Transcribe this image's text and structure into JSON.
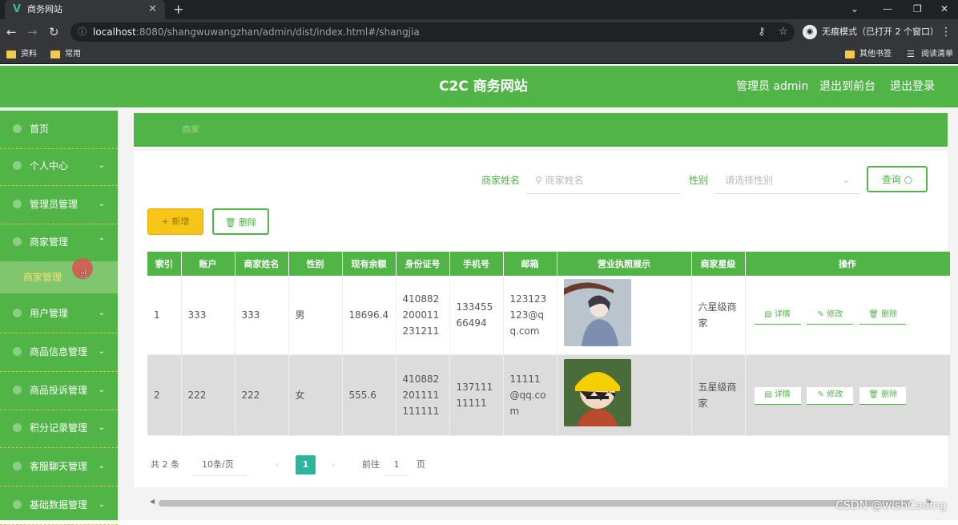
{
  "browser": {
    "tab_title": "商务网站",
    "tab_logo": "V",
    "close_glyph": "✕",
    "newtab_glyph": "+",
    "url_host": "localhost",
    "url_path": ":8080/shangwuwangzhan/admin/dist/index.html#/shangjia",
    "incognito_text": "无痕模式（已打开 2 个窗口）",
    "bookmarks": [
      "资料",
      "常用"
    ],
    "other_bookmarks": "其他书签",
    "reading_list": "阅读清单"
  },
  "header": {
    "title": "C2C 商务网站",
    "admin_label": "管理员 admin",
    "to_front": "退出到前台",
    "logout": "退出登录"
  },
  "sidebar": {
    "items": [
      {
        "label": "首页",
        "chevron": ""
      },
      {
        "label": "个人中心",
        "chevron": "⌄"
      },
      {
        "label": "管理员管理",
        "chevron": "⌄"
      },
      {
        "label": "商家管理",
        "chevron": "⌃"
      },
      {
        "label": "用户管理",
        "chevron": "⌄"
      },
      {
        "label": "商品信息管理",
        "chevron": "⌄"
      },
      {
        "label": "商品投诉管理",
        "chevron": "⌄"
      },
      {
        "label": "积分记录管理",
        "chevron": "⌄"
      },
      {
        "label": "客服聊天管理",
        "chevron": "⌄"
      },
      {
        "label": "基础数据管理",
        "chevron": "⌄"
      }
    ],
    "active_sub": "商家管理"
  },
  "breadcrumb": {
    "current": "商家"
  },
  "search": {
    "name_label": "商家姓名",
    "name_placeholder": "商家姓名",
    "gender_label": "性别",
    "gender_placeholder": "请选择性别",
    "query_button": "查询"
  },
  "actions": {
    "add": "新增",
    "delete": "删除"
  },
  "table": {
    "columns": [
      "索引",
      "账户",
      "商家姓名",
      "性别",
      "现有余额",
      "身份证号",
      "手机号",
      "邮箱",
      "营业执照展示",
      "商家星级",
      "操作"
    ],
    "rows": [
      {
        "index": "1",
        "account": "333",
        "name": "333",
        "gender": "男",
        "balance": "18696.4",
        "id_no": "410882200011231211",
        "phone": "13345566494",
        "email": "123123123@qq.com",
        "license": "portrait-umbrella",
        "stars": "六星级商家"
      },
      {
        "index": "2",
        "account": "222",
        "name": "222",
        "gender": "女",
        "balance": "555.6",
        "id_no": "410882201111111111",
        "phone": "13711111111",
        "email": "11111@qq.com",
        "license": "portrait-yellow-hat",
        "stars": "五星级商家"
      }
    ],
    "row_actions": {
      "detail": "详情",
      "edit": "修改",
      "delete": "删除"
    }
  },
  "pagination": {
    "total": "共 2 条",
    "page_size": "10条/页",
    "current_page": "1",
    "goto_prefix": "前往",
    "goto_value": "1",
    "goto_suffix": "页"
  },
  "watermark": "CSDN @wishCoding",
  "colors": {
    "primary": "#51b447",
    "yellow": "#f5c518"
  }
}
